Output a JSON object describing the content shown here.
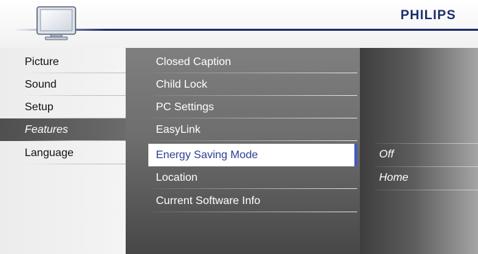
{
  "header": {
    "brand": "PHILIPS",
    "icon": "tv-icon"
  },
  "menu": {
    "categories": [
      {
        "label": "Picture",
        "selected": false
      },
      {
        "label": "Sound",
        "selected": false
      },
      {
        "label": "Setup",
        "selected": false
      },
      {
        "label": "Features",
        "selected": true
      },
      {
        "label": "Language",
        "selected": false
      }
    ],
    "features": [
      {
        "label": "Closed Caption",
        "highlighted": false
      },
      {
        "label": "Child Lock",
        "highlighted": false
      },
      {
        "label": "PC Settings",
        "highlighted": false
      },
      {
        "label": "EasyLink",
        "highlighted": false
      },
      {
        "label": "Energy Saving Mode",
        "highlighted": true
      },
      {
        "label": "Location",
        "highlighted": false
      },
      {
        "label": "Current Software Info",
        "highlighted": false
      }
    ],
    "options": [
      {
        "label": "Off"
      },
      {
        "label": "Home"
      }
    ]
  },
  "colors": {
    "brand": "#1c2f6c",
    "highlight_text": "#2a3f91",
    "highlight_border": "#3f5bc4"
  }
}
